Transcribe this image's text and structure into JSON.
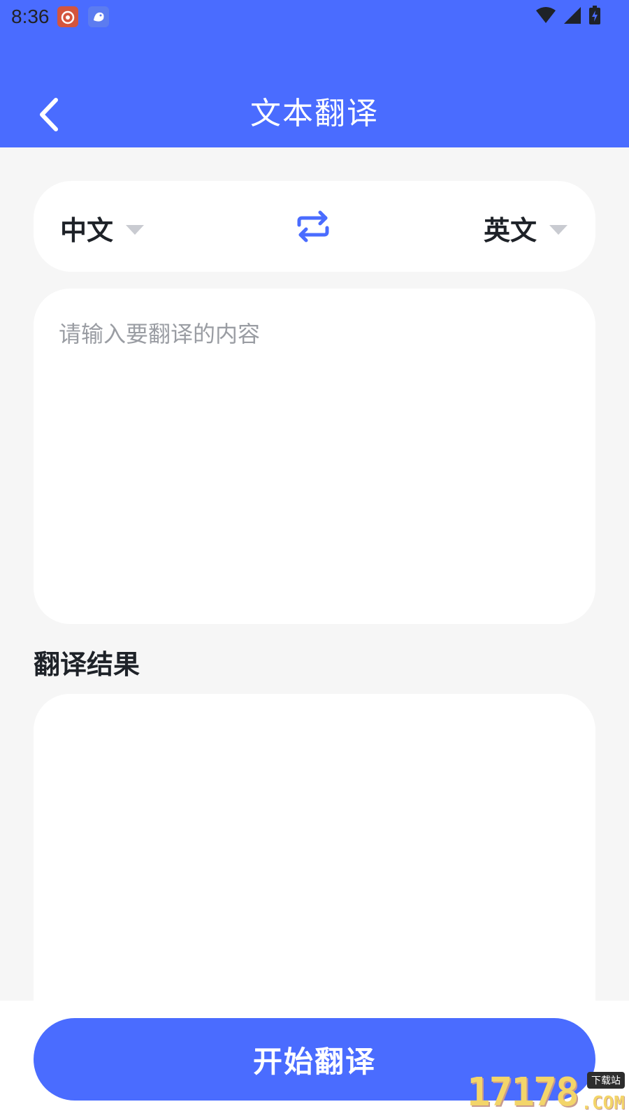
{
  "status_bar": {
    "time": "8:36",
    "icons": [
      "weibo-notification-icon",
      "bird-app-notification-icon",
      "wifi-icon",
      "signal-icon",
      "battery-charging-icon"
    ]
  },
  "header": {
    "title": "文本翻译",
    "back_icon": "chevron-left-icon"
  },
  "language_selector": {
    "source": "中文",
    "target": "英文",
    "swap_icon": "swap-arrows-icon"
  },
  "input": {
    "placeholder": "请输入要翻译的内容",
    "value": ""
  },
  "result": {
    "title": "翻译结果",
    "text": ""
  },
  "action": {
    "start_label": "开始翻译"
  },
  "watermark": {
    "digits": "17178",
    "tag": "下载站",
    "suffix": ".COM"
  },
  "colors": {
    "accent": "#4A6CFF",
    "background": "#F6F6F6",
    "card": "#FFFFFF",
    "text_primary": "#1E2228",
    "placeholder": "#9A9DA3"
  }
}
